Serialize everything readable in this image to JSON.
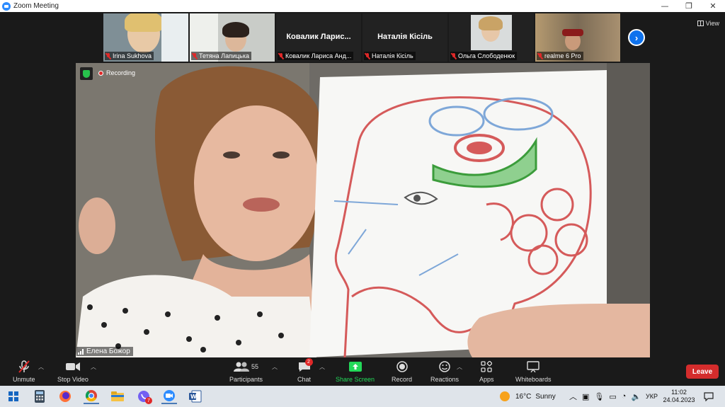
{
  "window": {
    "title": "Zoom Meeting",
    "controls": {
      "minimize": "—",
      "restore": "❐",
      "close": "✕"
    }
  },
  "view_button": {
    "label": "View"
  },
  "participants_strip": [
    {
      "name": "Irina Sukhova",
      "kind": "video"
    },
    {
      "name": "Тетяна Лапицька",
      "kind": "video"
    },
    {
      "name": "Ковалик Лариса Анд...",
      "kind": "name",
      "tile_text": "Ковалик  Ларис..."
    },
    {
      "name": "Наталія Кісіль",
      "kind": "name",
      "tile_text": "Наталія Кісіль"
    },
    {
      "name": "Ольга Слободенюк",
      "kind": "video"
    },
    {
      "name": "realme 6 Pro",
      "kind": "video"
    }
  ],
  "next_page": {
    "glyph": "›"
  },
  "main_video": {
    "recording_label": "Recording",
    "speaker_name": "Елена Божор"
  },
  "toolbar": {
    "unmute": "Unmute",
    "stop_video": "Stop Video",
    "participants": "Participants",
    "participants_count": "55",
    "chat": "Chat",
    "chat_badge": "2",
    "share_screen": "Share Screen",
    "record": "Record",
    "reactions": "Reactions",
    "apps": "Apps",
    "whiteboards": "Whiteboards",
    "leave": "Leave"
  },
  "taskbar": {
    "weather_temp": "16°C",
    "weather_text": "Sunny",
    "language": "УКР",
    "time": "11:02",
    "date": "24.04.2023",
    "viber_badge": "7"
  },
  "colors": {
    "zoom_blue": "#0e72ed",
    "share_green": "#23d959",
    "leave_red": "#d42c2c",
    "muted_red": "#e02828"
  }
}
